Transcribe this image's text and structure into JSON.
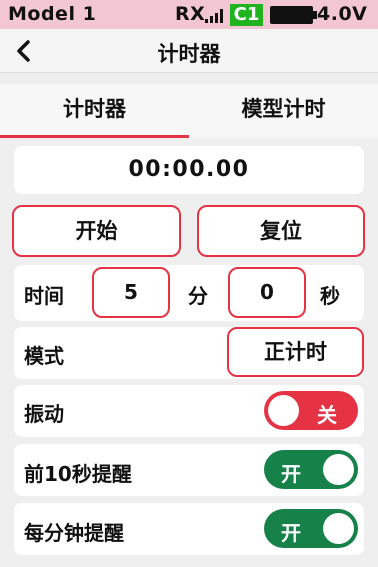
{
  "status": {
    "model": "Model 1",
    "rx": "RX",
    "channel_badge": "C1",
    "voltage": "4.0V",
    "icons": [
      "signal-icon",
      "battery-icon"
    ],
    "colors": {
      "bar": "#f3c6d3",
      "badge": "#1fb31f"
    }
  },
  "header": {
    "title": "计时器",
    "back_icon": "chevron-left-icon"
  },
  "tabs": [
    {
      "label": "计时器",
      "active": true
    },
    {
      "label": "模型计时",
      "active": false
    }
  ],
  "timer": {
    "display": "00:00.00",
    "start_label": "开始",
    "reset_label": "复位"
  },
  "time_setting": {
    "label": "时间",
    "minutes": "5",
    "minutes_unit": "分",
    "seconds": "0",
    "seconds_unit": "秒"
  },
  "mode": {
    "label": "模式",
    "value": "正计时"
  },
  "vibration": {
    "label": "振动",
    "state": "关",
    "on": false
  },
  "remind_10s": {
    "label": "前10秒提醒",
    "state": "开",
    "on": true
  },
  "remind_minute": {
    "label": "每分钟提醒",
    "state": "开",
    "on": true
  },
  "colors": {
    "accent": "#e53344",
    "toggle_on": "#16824a",
    "background": "#efefef"
  }
}
